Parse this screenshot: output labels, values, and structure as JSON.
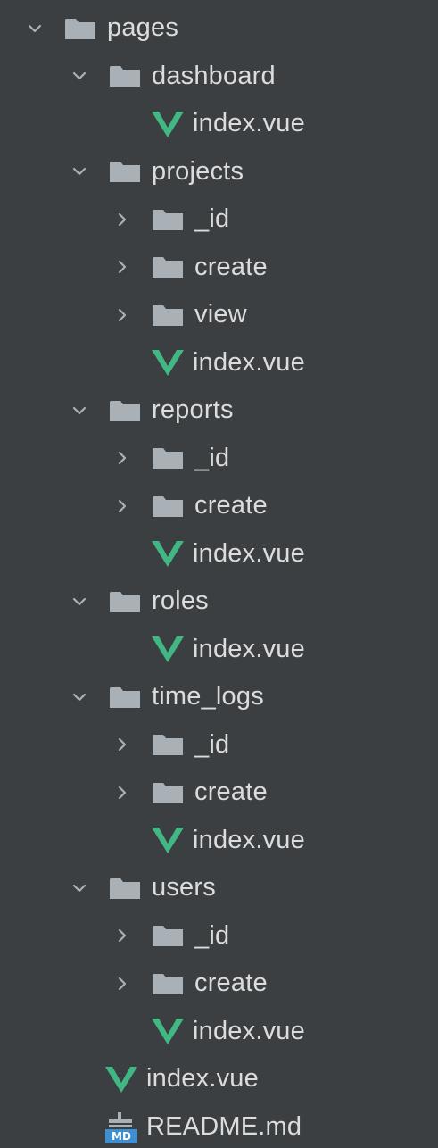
{
  "colors": {
    "background": "#3c3f41",
    "text": "#dcdcdc",
    "folder": "#a9b0b6",
    "arrow": "#a9b0b6",
    "vue_green": "#41b883",
    "md_blue": "#3d8fd1"
  },
  "tree": [
    {
      "depth": 0,
      "type": "folder",
      "expanded": true,
      "label": "pages",
      "icon": "folder-icon"
    },
    {
      "depth": 1,
      "type": "folder",
      "expanded": true,
      "label": "dashboard",
      "icon": "folder-icon"
    },
    {
      "depth": 2,
      "type": "file",
      "label": "index.vue",
      "icon": "vue-file-icon"
    },
    {
      "depth": 1,
      "type": "folder",
      "expanded": true,
      "label": "projects",
      "icon": "folder-icon"
    },
    {
      "depth": 2,
      "type": "folder",
      "expanded": false,
      "label": "_id",
      "icon": "folder-icon"
    },
    {
      "depth": 2,
      "type": "folder",
      "expanded": false,
      "label": "create",
      "icon": "folder-icon"
    },
    {
      "depth": 2,
      "type": "folder",
      "expanded": false,
      "label": "view",
      "icon": "folder-icon"
    },
    {
      "depth": 2,
      "type": "file",
      "label": "index.vue",
      "icon": "vue-file-icon"
    },
    {
      "depth": 1,
      "type": "folder",
      "expanded": true,
      "label": "reports",
      "icon": "folder-icon"
    },
    {
      "depth": 2,
      "type": "folder",
      "expanded": false,
      "label": "_id",
      "icon": "folder-icon"
    },
    {
      "depth": 2,
      "type": "folder",
      "expanded": false,
      "label": "create",
      "icon": "folder-icon"
    },
    {
      "depth": 2,
      "type": "file",
      "label": "index.vue",
      "icon": "vue-file-icon"
    },
    {
      "depth": 1,
      "type": "folder",
      "expanded": true,
      "label": "roles",
      "icon": "folder-icon"
    },
    {
      "depth": 2,
      "type": "file",
      "label": "index.vue",
      "icon": "vue-file-icon"
    },
    {
      "depth": 1,
      "type": "folder",
      "expanded": true,
      "label": "time_logs",
      "icon": "folder-icon"
    },
    {
      "depth": 2,
      "type": "folder",
      "expanded": false,
      "label": "_id",
      "icon": "folder-icon"
    },
    {
      "depth": 2,
      "type": "folder",
      "expanded": false,
      "label": "create",
      "icon": "folder-icon"
    },
    {
      "depth": 2,
      "type": "file",
      "label": "index.vue",
      "icon": "vue-file-icon"
    },
    {
      "depth": 1,
      "type": "folder",
      "expanded": true,
      "label": "users",
      "icon": "folder-icon"
    },
    {
      "depth": 2,
      "type": "folder",
      "expanded": false,
      "label": "_id",
      "icon": "folder-icon"
    },
    {
      "depth": 2,
      "type": "folder",
      "expanded": false,
      "label": "create",
      "icon": "folder-icon"
    },
    {
      "depth": 2,
      "type": "file",
      "label": "index.vue",
      "icon": "vue-file-icon"
    },
    {
      "depth": 1,
      "type": "file",
      "label": "index.vue",
      "icon": "vue-file-icon"
    },
    {
      "depth": 1,
      "type": "file",
      "label": "README.md",
      "icon": "markdown-file-icon"
    }
  ]
}
